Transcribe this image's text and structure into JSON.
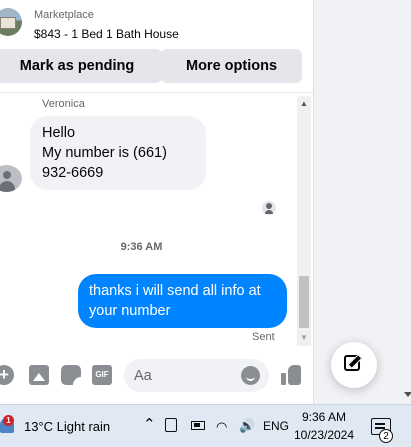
{
  "header": {
    "section": "Marketplace",
    "listing_title": "$843 - 1 Bed 1 Bath House",
    "pending_button": "Mark as pending",
    "more_button": "More options"
  },
  "conversation": {
    "sender_name": "Veronica",
    "incoming_message": "Hello\nMy number is (661)\n932-6669",
    "timestamp": "9:36 AM",
    "outgoing_message": "thanks i will send all info at your number",
    "delivery_status": "Sent"
  },
  "composer": {
    "placeholder": "Aa",
    "gif_label": "GIF"
  },
  "icons": {
    "plus": "+",
    "up_arrow": "▲",
    "down_arrow": "▼"
  },
  "taskbar": {
    "notification_count": "1",
    "weather": "13°C  Light rain",
    "chevron": "⌃",
    "wifi": "◠",
    "volume": "🔊",
    "language": "ENG",
    "time": "9:36 AM",
    "date": "10/23/2024",
    "notifications_badge": "2"
  },
  "colors": {
    "message_blue": "#0084ff",
    "incoming_bubble": "#f0f2f5",
    "button_gray": "#e4e6eb",
    "taskbar_blue": "#dfe8f3"
  }
}
